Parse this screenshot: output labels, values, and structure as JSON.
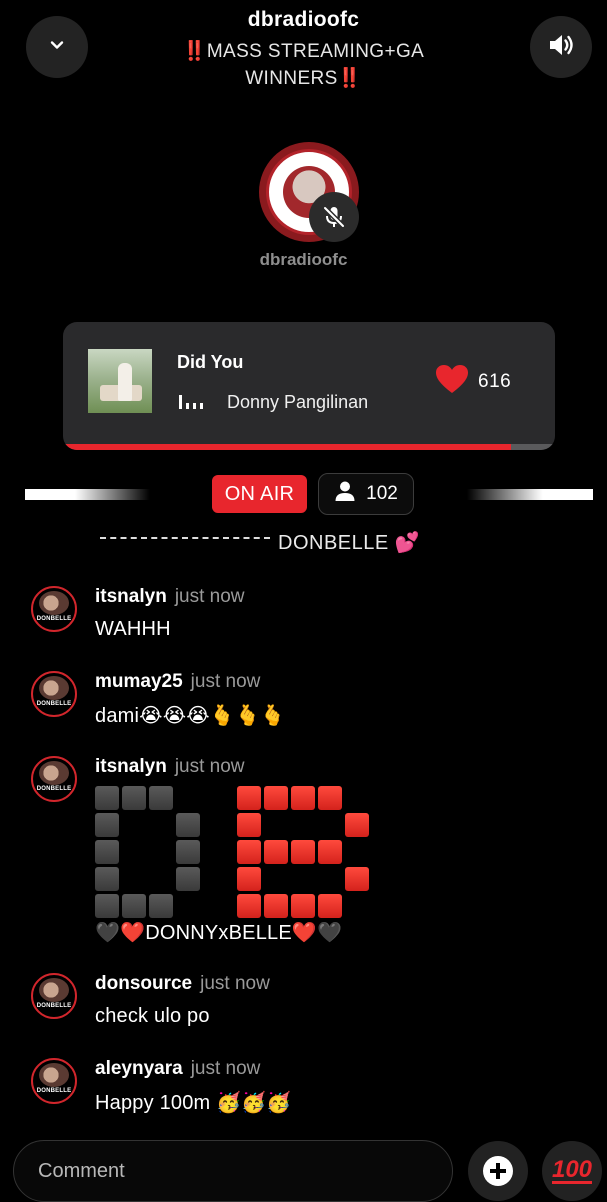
{
  "header": {
    "title": "dbradioofc",
    "subtitle_mark": "‼️",
    "subtitle": "MASS STREAMING+GA WINNERS"
  },
  "host": {
    "name": "dbradioofc",
    "muted": true
  },
  "now_playing": {
    "title": "Did You",
    "artist": "Donny Pangilinan",
    "likes": "616",
    "progress": 0.91
  },
  "live": {
    "status": "ON AIR",
    "listeners": "102"
  },
  "chat": {
    "cut_off_text": "DONBELLE 💕",
    "messages": [
      {
        "user": "itsnalyn",
        "time": "just now",
        "text": "WAHHH"
      },
      {
        "user": "mumay25",
        "time": "just now",
        "text": "dami😭😭😭🫰🫰🫰"
      },
      {
        "user": "itsnalyn",
        "time": "just now",
        "text": "🖤❤️DONNYxBELLE❤️🖤"
      },
      {
        "user": "donsource",
        "time": "just now",
        "text": "check ulo po"
      },
      {
        "user": "aleynyara",
        "time": "just now",
        "text": "Happy 100m 🥳🥳🥳"
      }
    ]
  },
  "composer": {
    "placeholder": "Comment",
    "reaction": "100"
  },
  "colors": {
    "accent": "#e8262d",
    "background": "#000000",
    "card": "#2a2a2c"
  },
  "icons": {
    "collapse": "chevron-down-icon",
    "volume": "speaker-icon",
    "mute": "mic-off-icon",
    "like": "heart-icon",
    "listeners": "user-icon",
    "add": "plus-icon",
    "reaction": "hundred-points-icon"
  }
}
